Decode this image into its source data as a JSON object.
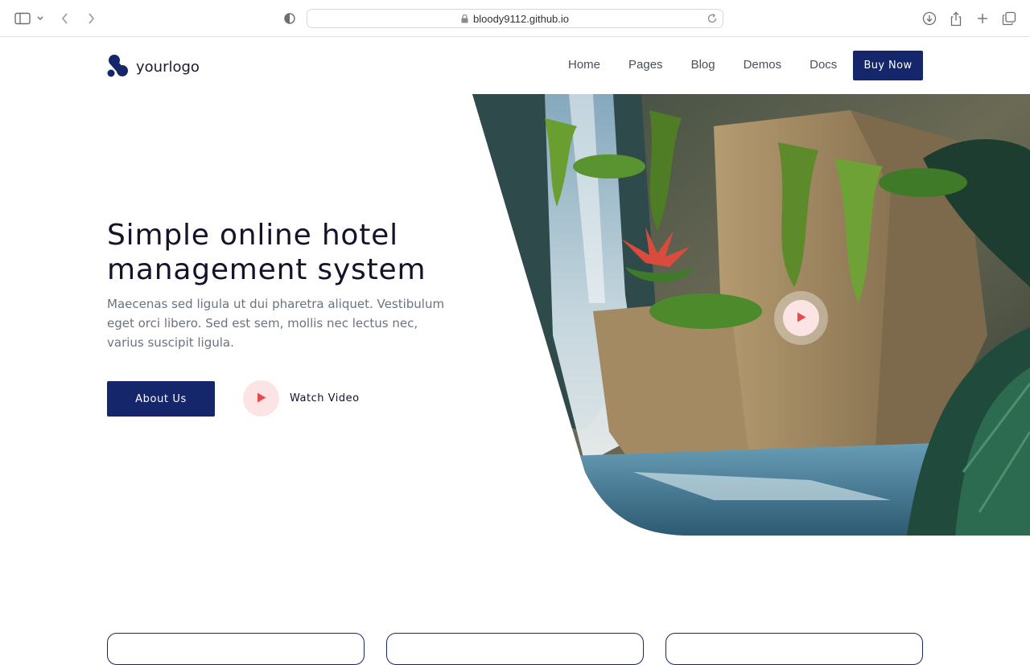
{
  "browser": {
    "url": "bloody9112.github.io",
    "icons": [
      "sidebar-icon",
      "chevron-down-icon",
      "back-icon",
      "forward-icon",
      "shield-icon",
      "lock-icon",
      "reload-icon",
      "download-icon",
      "share-icon",
      "new-tab-icon",
      "tabs-icon"
    ]
  },
  "header": {
    "logo_text": "yourlogo",
    "nav": [
      "Home",
      "Pages",
      "Blog",
      "Demos",
      "Docs"
    ],
    "cta_label": "Buy Now"
  },
  "hero": {
    "title": "Simple online hotel management system",
    "subtitle": "Maecenas sed ligula ut dui pharetra aliquet. Vestibulum eget orci libero. Sed est sem, mollis nec lectus nec, varius suscipit ligula.",
    "primary_button": "About Us",
    "video_label": "Watch Video"
  },
  "colors": {
    "brand": "#16266b",
    "play_bg": "#fde4e4",
    "play_icon": "#e84a4a",
    "text_dark": "#13132a",
    "text_muted": "#6b7280"
  }
}
